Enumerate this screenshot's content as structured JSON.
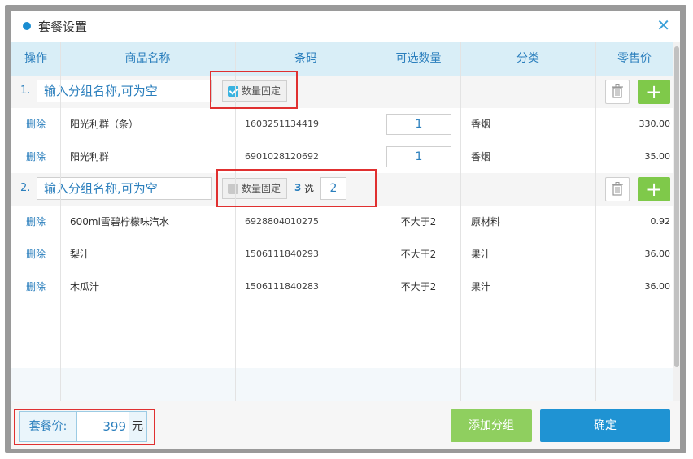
{
  "dialog": {
    "title": "套餐设置",
    "close_icon": "close-icon"
  },
  "columns": [
    "操作",
    "商品名称",
    "条码",
    "可选数量",
    "分类",
    "零售价"
  ],
  "groups": [
    {
      "index": "1.",
      "name_placeholder": "输入分组名称,可为空",
      "fixed_label": "数量固定",
      "fixed_checked": true,
      "items": [
        {
          "action": "删除",
          "name": "阳光利群（条）",
          "barcode": "1603251134419",
          "qty": "1",
          "category": "香烟",
          "price": "330.00"
        },
        {
          "action": "删除",
          "name": "阳光利群",
          "barcode": "6901028120692",
          "qty": "1",
          "category": "香烟",
          "price": "35.00"
        }
      ]
    },
    {
      "index": "2.",
      "name_placeholder": "输入分组名称,可为空",
      "fixed_label": "数量固定",
      "fixed_checked": false,
      "pick_total": "3",
      "pick_word": "选",
      "pick_value": "2",
      "items": [
        {
          "action": "删除",
          "name": "600ml雪碧柠檬味汽水",
          "barcode": "6928804010275",
          "qty": "不大于2",
          "category": "原材料",
          "price": "0.92"
        },
        {
          "action": "删除",
          "name": "梨汁",
          "barcode": "1506111840293",
          "qty": "不大于2",
          "category": "果汁",
          "price": "36.00"
        },
        {
          "action": "删除",
          "name": "木瓜汁",
          "barcode": "1506111840283",
          "qty": "不大于2",
          "category": "果汁",
          "price": "36.00"
        }
      ]
    }
  ],
  "footer": {
    "price_label": "套餐价:",
    "price_value": "399",
    "price_unit": "元",
    "add_group_label": "添加分组",
    "confirm_label": "确定"
  },
  "colors": {
    "accent": "#1f93d3",
    "header_bg": "#d9eef7",
    "green": "#7fc94a",
    "highlight": "#e03030"
  }
}
